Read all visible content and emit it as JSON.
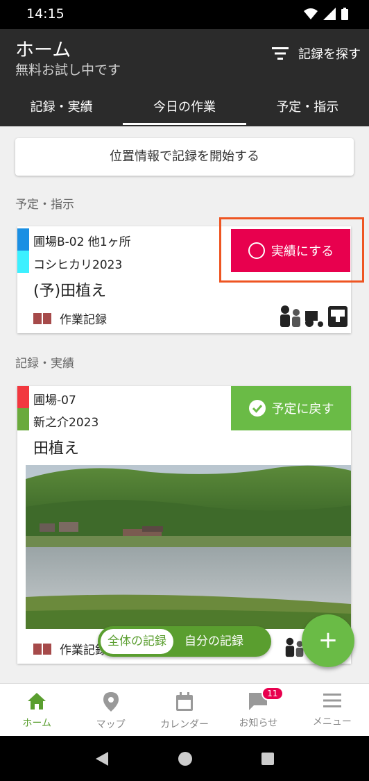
{
  "status_bar": {
    "time": "14:15"
  },
  "header": {
    "title": "ホーム",
    "subtitle": "無料お試し中です",
    "search_label": "記録を探す"
  },
  "tabs": [
    {
      "label": "記録・実績"
    },
    {
      "label": "今日の作業",
      "active": true
    },
    {
      "label": "予定・指示"
    }
  ],
  "location_button": "位置情報で記録を開始する",
  "sections": {
    "planned": "予定・指示",
    "records": "記録・実績"
  },
  "planned_card": {
    "field": "圃場B-02 他1ヶ所",
    "crop": "コシヒカリ2023",
    "work": "(予)田植え",
    "note": "作業記録",
    "action": "実績にする",
    "strip_colors": [
      "#1a8fe3",
      "#3cf0ff"
    ]
  },
  "record_card": {
    "field": "圃場-07",
    "crop": "新之介2023",
    "work": "田植え",
    "note": "作業記録",
    "action": "予定に戻す",
    "strip_colors": [
      "#f2383f",
      "#6aaa3c"
    ]
  },
  "record_toggle": {
    "all": "全体の記録",
    "mine": "自分の記録"
  },
  "fab": "+",
  "bottom_nav": [
    {
      "label": "ホーム",
      "icon": "home-icon",
      "active": true
    },
    {
      "label": "マップ",
      "icon": "map-pin-icon"
    },
    {
      "label": "カレンダー",
      "icon": "calendar-icon"
    },
    {
      "label": "お知らせ",
      "icon": "chat-icon",
      "badge": "11"
    },
    {
      "label": "メニュー",
      "icon": "menu-icon"
    }
  ],
  "colors": {
    "accent_green": "#6abb46",
    "action_red": "#e8004e",
    "highlight_orange": "#ee5522",
    "header_dark": "#2b2b2b"
  }
}
